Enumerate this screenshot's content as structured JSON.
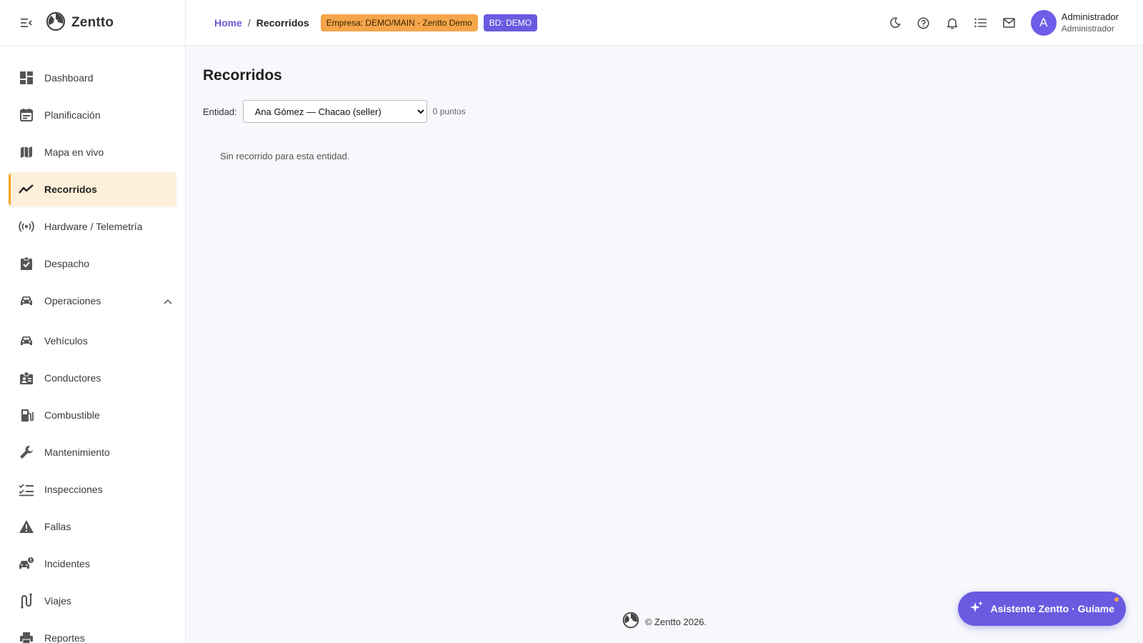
{
  "brand": {
    "name": "Zentto"
  },
  "sidebar": {
    "items": [
      {
        "label": "Dashboard",
        "icon": "dashboard-icon"
      },
      {
        "label": "Planificación",
        "icon": "calendar-icon"
      },
      {
        "label": "Mapa en vivo",
        "icon": "map-icon"
      },
      {
        "label": "Recorridos",
        "icon": "trending-line-icon",
        "active": true
      },
      {
        "label": "Hardware / Telemetría",
        "icon": "broadcast-icon"
      },
      {
        "label": "Despacho",
        "icon": "clipboard-check-icon"
      },
      {
        "label": "Operaciones",
        "icon": "car-icon",
        "expanded": true
      },
      {
        "label": "Vehículos",
        "icon": "car-icon"
      },
      {
        "label": "Conductores",
        "icon": "id-badge-icon"
      },
      {
        "label": "Combustible",
        "icon": "fuel-pump-icon"
      },
      {
        "label": "Mantenimiento",
        "icon": "wrench-icon"
      },
      {
        "label": "Inspecciones",
        "icon": "checklist-icon"
      },
      {
        "label": "Fallas",
        "icon": "warning-icon"
      },
      {
        "label": "Incidentes",
        "icon": "car-crash-icon"
      },
      {
        "label": "Viajes",
        "icon": "route-icon"
      },
      {
        "label": "Reportes",
        "icon": "printer-icon"
      }
    ]
  },
  "header": {
    "breadcrumb": {
      "home": "Home",
      "separator": "/",
      "current": "Recorridos"
    },
    "empresa_chip": "Empresa: DEMO/MAIN - Zentto Demo",
    "bd_chip": "BD: DEMO",
    "icons": [
      "dark-mode-icon",
      "help-icon",
      "bell-icon",
      "list-icon",
      "mail-icon"
    ],
    "user": {
      "initial": "A",
      "name": "Administrador",
      "role": "Administrador"
    }
  },
  "main": {
    "title": "Recorridos",
    "filter": {
      "label": "Entidad:",
      "selected": "Ana Gómez — Chacao (seller)",
      "points": "0 puntos"
    },
    "empty_message": "Sin recorrido para esta entidad."
  },
  "footer": {
    "text": "© Zentto 2026."
  },
  "assistant": {
    "label": "Asistente Zentto · Guíame"
  },
  "colors": {
    "accent": "#6a5ae0",
    "active_bg": "#fdefd9",
    "active_bar": "#f5a623",
    "empresa_chip": "#f5a54a",
    "background": "#f7f8fb"
  }
}
